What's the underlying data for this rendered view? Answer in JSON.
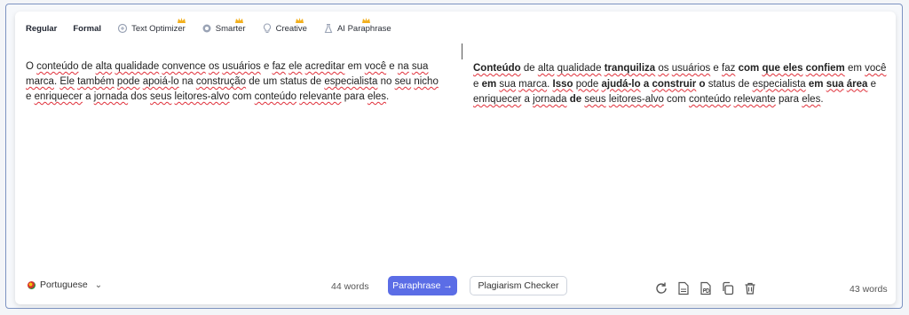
{
  "modes": [
    {
      "label": "Regular",
      "icon": "",
      "premium": false
    },
    {
      "label": "Formal",
      "icon": "",
      "premium": false
    },
    {
      "label": "Text Optimizer",
      "icon": "optimizer-icon",
      "premium": true
    },
    {
      "label": "Smarter",
      "icon": "smarter-icon",
      "premium": true
    },
    {
      "label": "Creative",
      "icon": "creative-icon",
      "premium": true
    },
    {
      "label": "AI Paraphrase",
      "icon": "ai-paraphrase-icon",
      "premium": true
    }
  ],
  "input": {
    "segments": [
      {
        "t": "O ",
        "c": ""
      },
      {
        "t": "conteúdo",
        "c": "w"
      },
      {
        "t": " de ",
        "c": ""
      },
      {
        "t": "alta",
        "c": "w"
      },
      {
        "t": " ",
        "c": ""
      },
      {
        "t": "qualidade",
        "c": "w"
      },
      {
        "t": " ",
        "c": ""
      },
      {
        "t": "convence",
        "c": "w"
      },
      {
        "t": " ",
        "c": ""
      },
      {
        "t": "os",
        "c": "w"
      },
      {
        "t": " ",
        "c": ""
      },
      {
        "t": "usuários",
        "c": "w"
      },
      {
        "t": " e ",
        "c": ""
      },
      {
        "t": "faz",
        "c": "w"
      },
      {
        "t": " ",
        "c": ""
      },
      {
        "t": "ele",
        "c": "w"
      },
      {
        "t": " ",
        "c": ""
      },
      {
        "t": "acreditar",
        "c": "w"
      },
      {
        "t": " em ",
        "c": ""
      },
      {
        "t": "você",
        "c": "w"
      },
      {
        "t": " e ",
        "c": ""
      },
      {
        "t": "na",
        "c": "w"
      },
      {
        "t": " ",
        "c": ""
      },
      {
        "t": "sua",
        "c": "w"
      },
      {
        "t": " ",
        "c": ""
      },
      {
        "t": "marca",
        "c": "w"
      },
      {
        "t": ". ",
        "c": ""
      },
      {
        "t": "Ele",
        "c": "w"
      },
      {
        "t": " ",
        "c": ""
      },
      {
        "t": "também",
        "c": "w"
      },
      {
        "t": " ",
        "c": ""
      },
      {
        "t": "pode",
        "c": "w"
      },
      {
        "t": " ",
        "c": ""
      },
      {
        "t": "apoiá-lo",
        "c": "w"
      },
      {
        "t": " na ",
        "c": ""
      },
      {
        "t": "construção",
        "c": "w"
      },
      {
        "t": " de um status de ",
        "c": ""
      },
      {
        "t": "especialista",
        "c": "w"
      },
      {
        "t": " no ",
        "c": ""
      },
      {
        "t": "seu",
        "c": "w"
      },
      {
        "t": " ",
        "c": ""
      },
      {
        "t": "nicho",
        "c": "w"
      },
      {
        "t": " e ",
        "c": ""
      },
      {
        "t": "enriquecer",
        "c": "w"
      },
      {
        "t": " a ",
        "c": ""
      },
      {
        "t": "jornada",
        "c": "w"
      },
      {
        "t": " dos ",
        "c": ""
      },
      {
        "t": "seus",
        "c": "w"
      },
      {
        "t": " ",
        "c": ""
      },
      {
        "t": "leitores-alvo",
        "c": "w"
      },
      {
        "t": " com ",
        "c": ""
      },
      {
        "t": "conteúdo",
        "c": "w"
      },
      {
        "t": " ",
        "c": ""
      },
      {
        "t": "relevante",
        "c": "w"
      },
      {
        "t": " para ",
        "c": ""
      },
      {
        "t": "eles",
        "c": "w"
      },
      {
        "t": ".",
        "c": ""
      }
    ],
    "word_count": "44 words"
  },
  "output": {
    "segments": [
      {
        "t": "Conteúdo",
        "c": "w b"
      },
      {
        "t": " de ",
        "c": ""
      },
      {
        "t": "alta",
        "c": "w"
      },
      {
        "t": " ",
        "c": ""
      },
      {
        "t": "qualidade",
        "c": "w"
      },
      {
        "t": " ",
        "c": ""
      },
      {
        "t": "tranquiliza",
        "c": "w b"
      },
      {
        "t": " ",
        "c": ""
      },
      {
        "t": "os",
        "c": "w"
      },
      {
        "t": " ",
        "c": ""
      },
      {
        "t": "usuários",
        "c": "w"
      },
      {
        "t": " e ",
        "c": ""
      },
      {
        "t": "faz",
        "c": "w"
      },
      {
        "t": " ",
        "c": ""
      },
      {
        "t": "com",
        "c": "b"
      },
      {
        "t": " ",
        "c": ""
      },
      {
        "t": "que eles",
        "c": "w b"
      },
      {
        "t": " ",
        "c": ""
      },
      {
        "t": "confiem",
        "c": "w b"
      },
      {
        "t": " em ",
        "c": ""
      },
      {
        "t": "você",
        "c": "w"
      },
      {
        "t": " e ",
        "c": ""
      },
      {
        "t": "em",
        "c": "b"
      },
      {
        "t": " ",
        "c": ""
      },
      {
        "t": "sua",
        "c": "w"
      },
      {
        "t": " ",
        "c": ""
      },
      {
        "t": "marca",
        "c": "w"
      },
      {
        "t": ". ",
        "c": ""
      },
      {
        "t": "Isso",
        "c": "w b"
      },
      {
        "t": " ",
        "c": ""
      },
      {
        "t": "pode",
        "c": "w"
      },
      {
        "t": " ",
        "c": ""
      },
      {
        "t": "ajudá-lo",
        "c": "w b"
      },
      {
        "t": " ",
        "c": ""
      },
      {
        "t": "a",
        "c": "b"
      },
      {
        "t": " ",
        "c": ""
      },
      {
        "t": "construir",
        "c": "w b"
      },
      {
        "t": " ",
        "c": ""
      },
      {
        "t": "o",
        "c": "b"
      },
      {
        "t": " status de ",
        "c": ""
      },
      {
        "t": "especialista",
        "c": "w"
      },
      {
        "t": " ",
        "c": ""
      },
      {
        "t": "em",
        "c": "b"
      },
      {
        "t": " ",
        "c": ""
      },
      {
        "t": "sua",
        "c": "w b"
      },
      {
        "t": " ",
        "c": ""
      },
      {
        "t": "área",
        "c": "w b"
      },
      {
        "t": " e ",
        "c": ""
      },
      {
        "t": "enriquecer",
        "c": "w"
      },
      {
        "t": " a ",
        "c": ""
      },
      {
        "t": "jornada",
        "c": "w"
      },
      {
        "t": " ",
        "c": ""
      },
      {
        "t": "de",
        "c": "b"
      },
      {
        "t": " ",
        "c": ""
      },
      {
        "t": "seus",
        "c": "w"
      },
      {
        "t": " ",
        "c": ""
      },
      {
        "t": "leitores-alvo",
        "c": "w"
      },
      {
        "t": " com ",
        "c": ""
      },
      {
        "t": "conteúdo",
        "c": "w"
      },
      {
        "t": " ",
        "c": ""
      },
      {
        "t": "relevante",
        "c": "w"
      },
      {
        "t": " para ",
        "c": ""
      },
      {
        "t": "eles",
        "c": "w"
      },
      {
        "t": ".",
        "c": ""
      }
    ],
    "word_count": "43 words"
  },
  "footer": {
    "language": "Portuguese",
    "paraphrase_label": "Paraphrase →",
    "plagiarism_label": "Plagiarism Checker",
    "tools": [
      "refresh-icon",
      "download-doc-icon",
      "download-pdf-icon",
      "copy-icon",
      "trash-icon"
    ]
  },
  "colors": {
    "accent": "#5b6de6",
    "spell_underline": "#e0303a",
    "frame_border": "#7d93c2"
  }
}
